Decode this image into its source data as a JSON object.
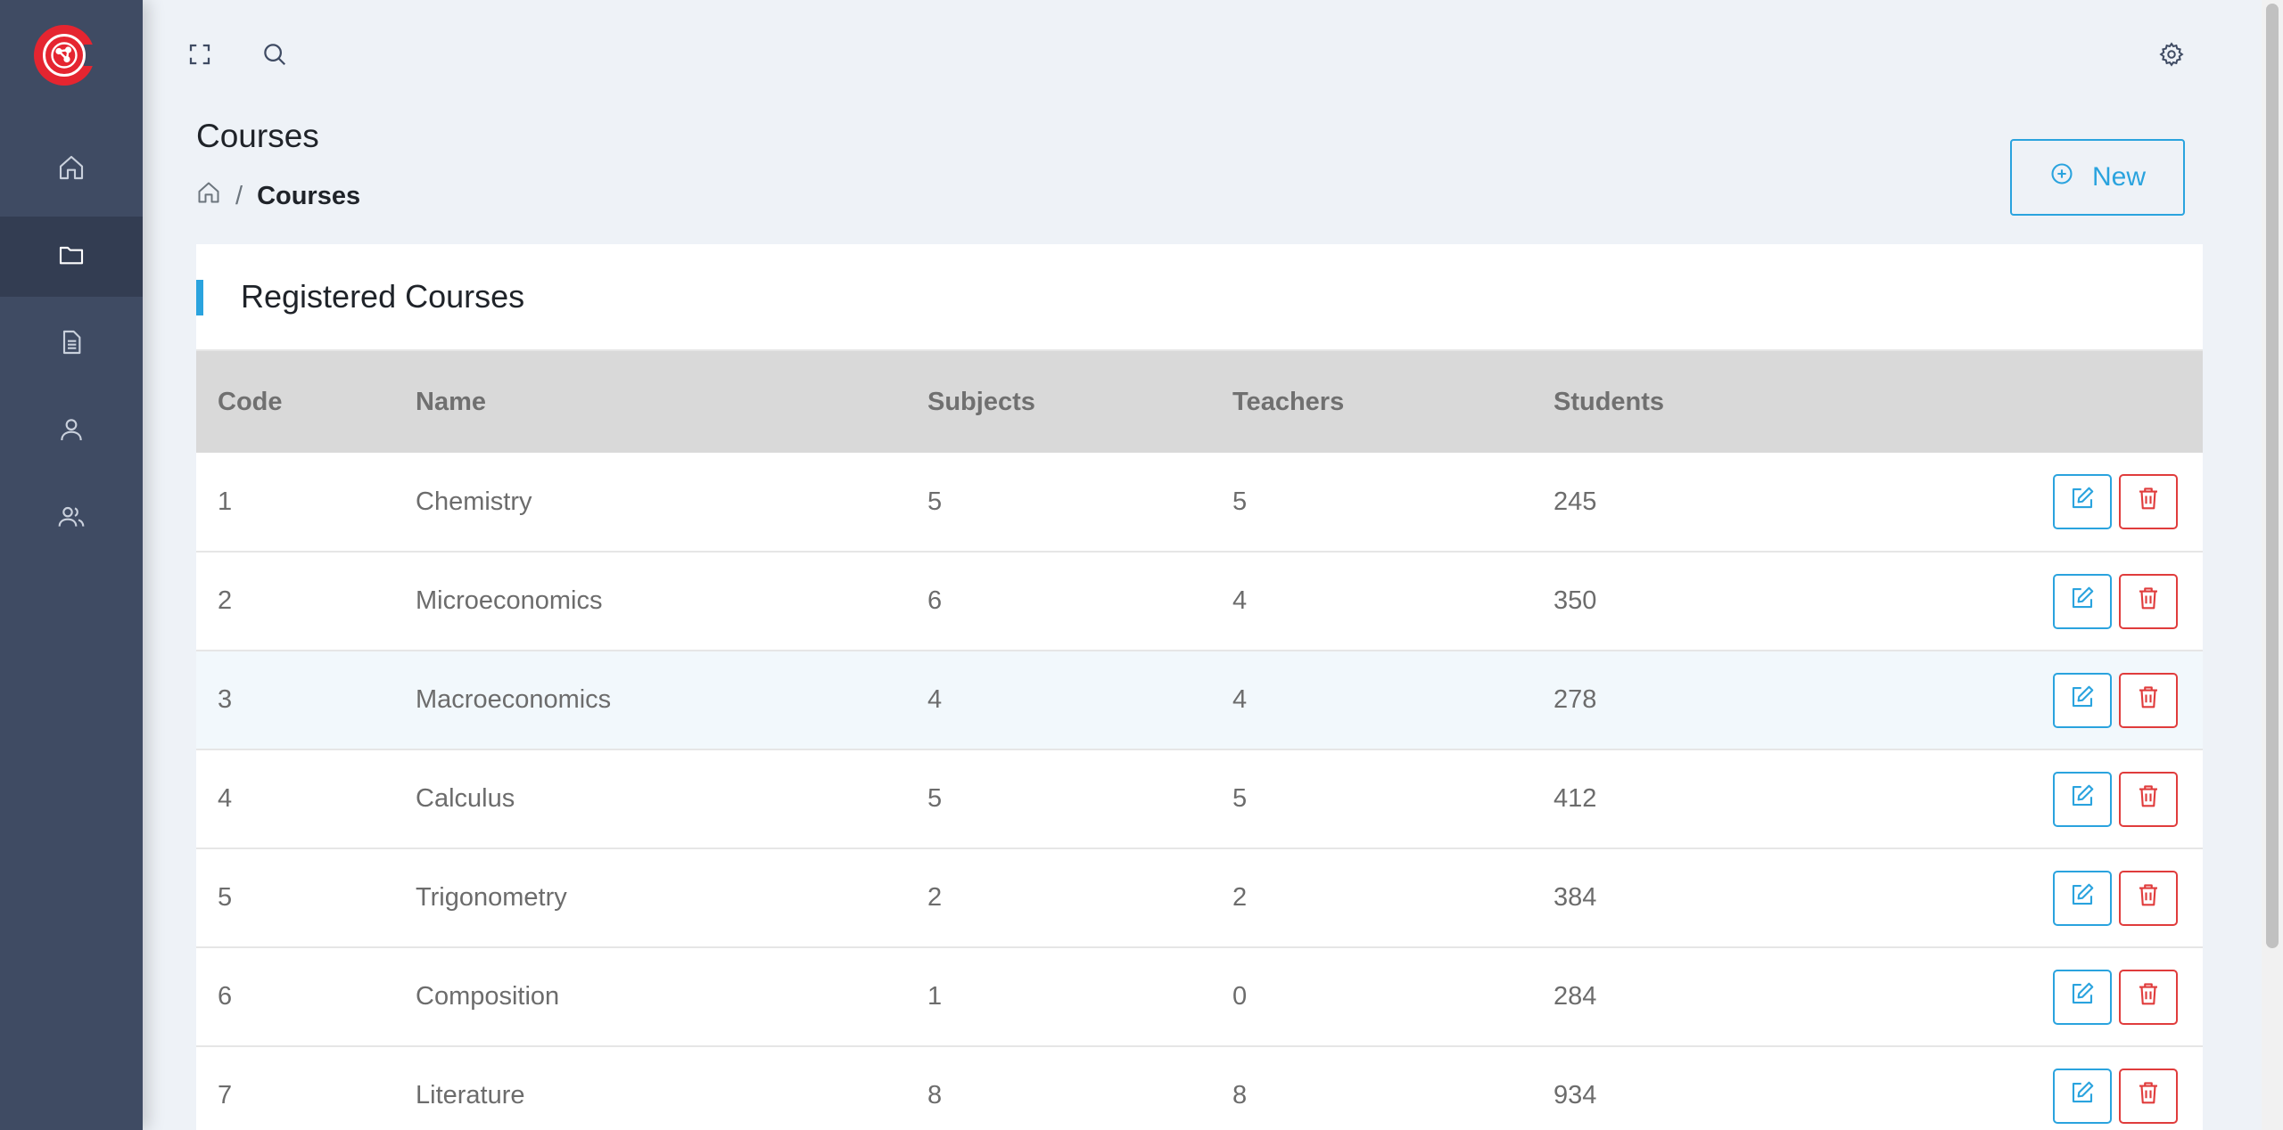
{
  "sidebar": {
    "logo_icon": "globe-network-logo",
    "items": [
      {
        "name": "home",
        "icon": "home-icon",
        "active": false
      },
      {
        "name": "courses",
        "icon": "folder-icon",
        "active": true
      },
      {
        "name": "subjects",
        "icon": "document-icon",
        "active": false
      },
      {
        "name": "teachers",
        "icon": "user-icon",
        "active": false
      },
      {
        "name": "students",
        "icon": "users-icon",
        "active": false
      }
    ]
  },
  "topbar": {
    "fullscreen_icon": "fullscreen-icon",
    "search_icon": "search-icon",
    "settings_icon": "gear-icon"
  },
  "page": {
    "title": "Courses",
    "breadcrumb": {
      "separator": "/",
      "current": "Courses"
    },
    "new_button": "New"
  },
  "card": {
    "title": "Registered Courses",
    "columns": [
      "Code",
      "Name",
      "Subjects",
      "Teachers",
      "Students"
    ],
    "rows": [
      {
        "code": "1",
        "name": "Chemistry",
        "subjects": "5",
        "teachers": "5",
        "students": "245"
      },
      {
        "code": "2",
        "name": "Microeconomics",
        "subjects": "6",
        "teachers": "4",
        "students": "350"
      },
      {
        "code": "3",
        "name": "Macroeconomics",
        "subjects": "4",
        "teachers": "4",
        "students": "278"
      },
      {
        "code": "4",
        "name": "Calculus",
        "subjects": "5",
        "teachers": "5",
        "students": "412"
      },
      {
        "code": "5",
        "name": "Trigonometry",
        "subjects": "2",
        "teachers": "2",
        "students": "384"
      },
      {
        "code": "6",
        "name": "Composition",
        "subjects": "1",
        "teachers": "0",
        "students": "284"
      },
      {
        "code": "7",
        "name": "Literature",
        "subjects": "8",
        "teachers": "8",
        "students": "934"
      }
    ]
  },
  "colors": {
    "accent": "#2aa3de",
    "danger": "#e03c3c",
    "sidebar": "#3f4b63",
    "logo": "#e52530"
  }
}
